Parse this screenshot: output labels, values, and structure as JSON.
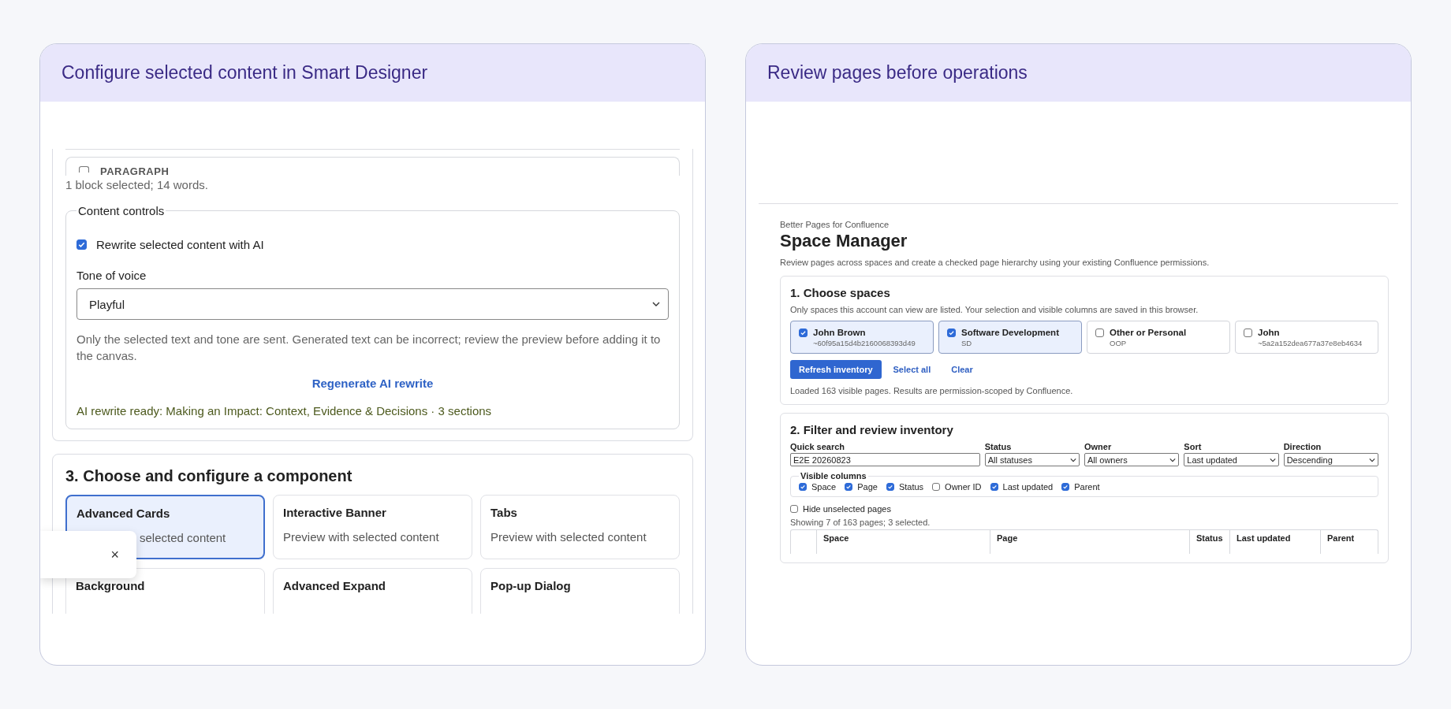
{
  "left": {
    "title": "Configure selected content in Smart Designer",
    "editor": {
      "paragraph_block": {
        "label": "PARAGRAPH",
        "checked": false
      },
      "selection_summary": "1 block selected; 14 words.",
      "content_controls": {
        "legend": "Content controls",
        "rewrite": {
          "label": "Rewrite selected content with AI",
          "checked": true
        },
        "tone": {
          "label": "Tone of voice",
          "value": "Playful"
        },
        "note": "Only the selected text and tone are sent. Generated text can be incorrect; review the preview before adding it to the canvas.",
        "regenerate_button": "Regenerate AI rewrite",
        "status": "AI rewrite ready: Making an Impact: Context, Evidence & Decisions · 3 sections"
      },
      "component_section": {
        "heading": "3. Choose and configure a component",
        "components": [
          {
            "name": "Advanced Cards",
            "description": "selected content",
            "selected": true
          },
          {
            "name": "Interactive Banner",
            "description": "Preview with selected content",
            "selected": false
          },
          {
            "name": "Tabs",
            "description": "Preview with selected content",
            "selected": false
          },
          {
            "name": "Background",
            "selected": false
          },
          {
            "name": "Advanced Expand",
            "selected": false
          },
          {
            "name": "Pop-up Dialog",
            "selected": false
          }
        ]
      },
      "toast": {
        "close": "×"
      }
    }
  },
  "right": {
    "title": "Review pages before operations",
    "app": {
      "brand": "Better Pages for Confluence",
      "heading": "Space Manager",
      "intro": "Review pages across spaces and create a checked page hierarchy using your existing Confluence permissions.",
      "spaces_section": {
        "heading": "1. Choose spaces",
        "hint": "Only spaces this account can view are listed. Your selection and visible columns are saved in this browser.",
        "spaces": [
          {
            "name": "John Brown",
            "key": "~60f95a15d4b2160068393d49",
            "checked": true
          },
          {
            "name": "Software Development",
            "key": "SD",
            "checked": true
          },
          {
            "name": "Other or Personal",
            "key": "OOP",
            "checked": false
          },
          {
            "name": "John",
            "key": "~5a2a152dea677a37e8eb4634",
            "checked": false
          }
        ],
        "buttons": [
          {
            "label": "Refresh inventory",
            "kind": "primary"
          },
          {
            "label": "Select all",
            "kind": "link"
          },
          {
            "label": "Clear",
            "kind": "link"
          }
        ],
        "loaded": "Loaded 163 visible pages. Results are permission-scoped by Confluence."
      },
      "filter_section": {
        "heading": "2. Filter and review inventory",
        "filters": [
          {
            "label": "Quick search",
            "value": "E2E 20260823",
            "kind": "text"
          },
          {
            "label": "Status",
            "value": "All statuses",
            "kind": "select"
          },
          {
            "label": "Owner",
            "value": "All owners",
            "kind": "select"
          },
          {
            "label": "Sort",
            "value": "Last updated",
            "kind": "select"
          },
          {
            "label": "Direction",
            "value": "Descending",
            "kind": "select"
          }
        ],
        "visible_columns": {
          "legend": "Visible columns",
          "columns": [
            {
              "label": "Space",
              "checked": true
            },
            {
              "label": "Page",
              "checked": true
            },
            {
              "label": "Status",
              "checked": true
            },
            {
              "label": "Owner ID",
              "checked": false
            },
            {
              "label": "Last updated",
              "checked": true
            },
            {
              "label": "Parent",
              "checked": true
            }
          ]
        },
        "hide_unselected": {
          "label": "Hide unselected pages",
          "checked": false
        },
        "showing": "Showing 7 of 163 pages; 3 selected.",
        "table_columns": [
          "Space",
          "Page",
          "Status",
          "Last updated",
          "Parent"
        ]
      }
    }
  }
}
